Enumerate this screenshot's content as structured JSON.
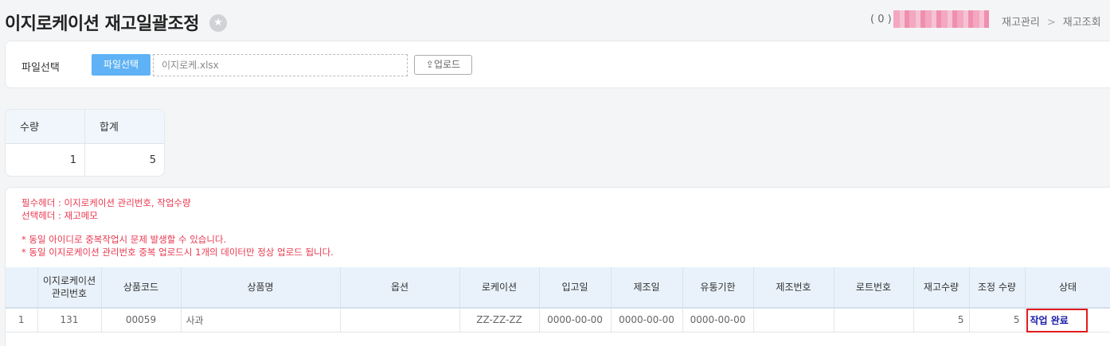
{
  "header": {
    "title": "이지로케이션 재고일괄조정",
    "user_count": "( 0 )",
    "breadcrumb": [
      "재고관리",
      "재고조회"
    ]
  },
  "upload": {
    "label": "파일선택",
    "select_button": "파일선택",
    "file_name": "이지로케.xlsx",
    "upload_button": "업로드"
  },
  "summary": {
    "headers": [
      "수량",
      "합계"
    ],
    "values": [
      "1",
      "5"
    ]
  },
  "notices": {
    "required": "필수헤더 : 이지로케이션 관리번호, 작업수량",
    "optional": "선택헤더 : 재고메모",
    "warning1": "* 동일 아이디로 중복작업시 문제 발생할 수 있습니다.",
    "warning2": "* 동일 이지로케이션 관리번호 중복 업로드시 1개의 데이터만 정상 업로드 됩니다."
  },
  "grid": {
    "columns": [
      "",
      "이지로케이션\n관리번호",
      "상품코드",
      "상품명",
      "옵션",
      "로케이션",
      "입고일",
      "제조일",
      "유통기한",
      "제조번호",
      "로트번호",
      "재고수량",
      "조정 수량",
      "상태"
    ],
    "rows": [
      {
        "no": "1",
        "mgmt_no": "131",
        "product_code": "00059",
        "product_name": "사과",
        "option": "",
        "location": "ZZ-ZZ-ZZ",
        "in_date": "0000-00-00",
        "mfg_date": "0000-00-00",
        "expiry": "0000-00-00",
        "mfg_no": "",
        "lot_no": "",
        "stock_qty": "5",
        "adjust_qty": "5",
        "status": "작업 완료"
      }
    ]
  },
  "colors": {
    "accent": "#5fb2f5",
    "notice": "#e8384f",
    "status": "#1a1aa8",
    "highlight": "#e21b1b",
    "grid_header": "#e9f2fb"
  }
}
